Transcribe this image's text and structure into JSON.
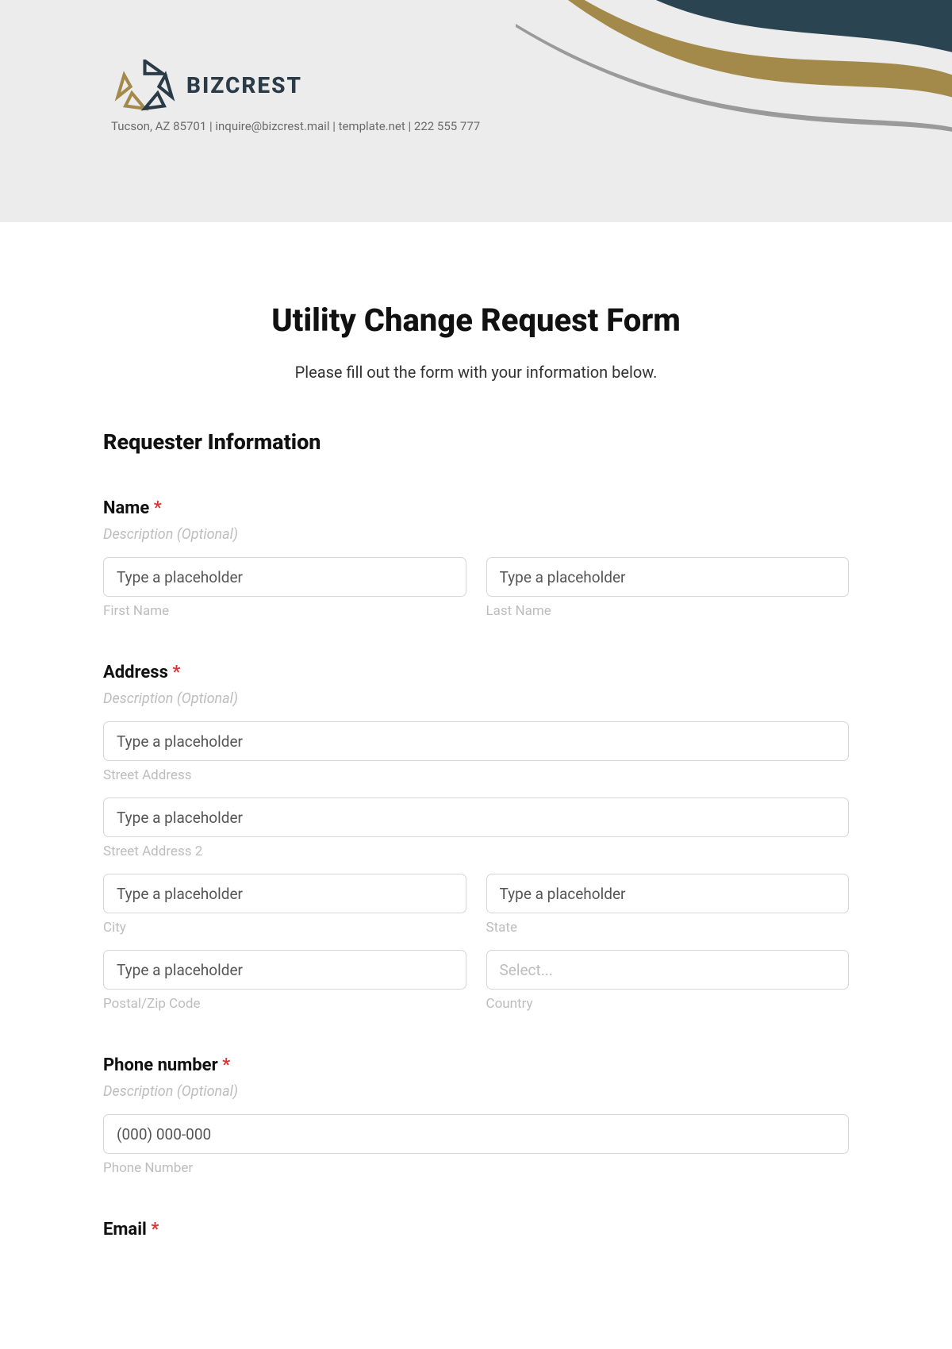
{
  "brand": {
    "name": "BIZCREST",
    "contact": "Tucson, AZ 85701 | inquire@bizcrest.mail | template.net | 222 555 777"
  },
  "page": {
    "title": "Utility Change Request Form",
    "subtitle": "Please fill out the form with your information below."
  },
  "section": {
    "requester": "Requester Information"
  },
  "name": {
    "label": "Name",
    "required": "*",
    "desc": "Description (Optional)",
    "first_placeholder": "Type a placeholder",
    "first_sub": "First Name",
    "last_placeholder": "Type a placeholder",
    "last_sub": "Last Name"
  },
  "address": {
    "label": "Address",
    "required": "*",
    "desc": "Description (Optional)",
    "street_placeholder": "Type a placeholder",
    "street_sub": "Street Address",
    "street2_placeholder": "Type a placeholder",
    "street2_sub": "Street Address 2",
    "city_placeholder": "Type a placeholder",
    "city_sub": "City",
    "state_placeholder": "Type a placeholder",
    "state_sub": "State",
    "postal_placeholder": "Type a placeholder",
    "postal_sub": "Postal/Zip Code",
    "country_selected": "Select...",
    "country_sub": "Country"
  },
  "phone": {
    "label": "Phone number",
    "required": "*",
    "desc": "Description (Optional)",
    "placeholder": "(000) 000-000",
    "sub": "Phone Number"
  },
  "email": {
    "label": "Email",
    "required": "*"
  }
}
